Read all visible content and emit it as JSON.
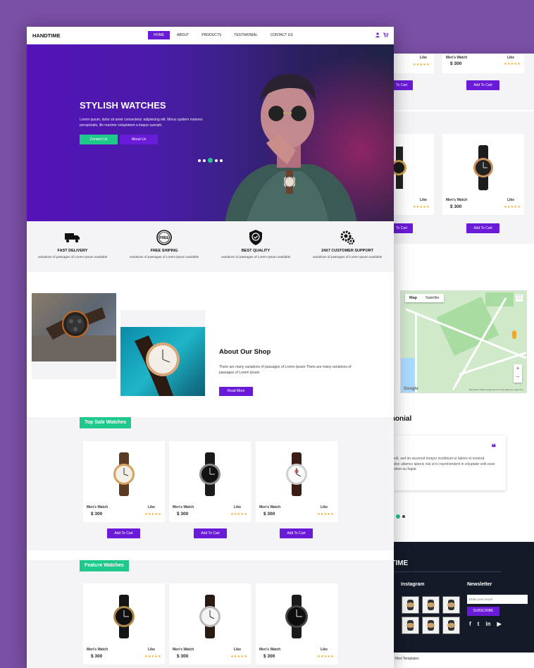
{
  "colors": {
    "accent": "#6a1bd8",
    "green": "#1ec98b",
    "star": "#f5a623",
    "footer": "#141a27"
  },
  "nav": {
    "brand": "HANDTIME",
    "items": [
      "HOME",
      "ABOUT",
      "PRODUCTS",
      "TESTIMONIAL",
      "CONTACT US"
    ],
    "active": 0
  },
  "hero": {
    "title": "STYLISH WATCHES",
    "text": "Lorem ipsum, dolor sit amet consectetur adipisicing elit. Minus quidem maiores perspiciatis, illo maxime voluptatem a itaque suscipit.",
    "btn_contact": "Contact Us",
    "btn_about": "About Us"
  },
  "features": [
    {
      "icon": "truck-icon",
      "title": "FAST DELIVERY",
      "desc": "variations of passages of Lorem Ipsum available"
    },
    {
      "icon": "free-badge-icon",
      "title": "FREE SHIPING",
      "desc": "variations of passages of Lorem Ipsum available"
    },
    {
      "icon": "quality-shield-icon",
      "title": "BEST QUALITY",
      "desc": "variations of passages of Lorem Ipsum available"
    },
    {
      "icon": "support-gear-icon",
      "title": "24X7 CUSTOMER SUPPORT",
      "desc": "variations of passages of Lorem Ipsum available"
    }
  ],
  "about": {
    "title": "About Our Shop",
    "text": "There are many variations of passages of Lorem Ipsum There are many variations of passages of Lorem Ipsum",
    "btn": "Read More"
  },
  "top_sale": {
    "label": "Top Sale Watches",
    "products": [
      {
        "name": "Men's Watch",
        "like": "Like",
        "price": "$ 300",
        "stars": "★★★★★",
        "btn": "Add To Cart"
      },
      {
        "name": "Men's Watch",
        "like": "Like",
        "price": "$ 300",
        "stars": "★★★★★",
        "btn": "Add To Cart"
      },
      {
        "name": "Men's Watch",
        "like": "Like",
        "price": "$ 300",
        "stars": "★★★★★",
        "btn": "Add To Cart"
      }
    ]
  },
  "feature_watches": {
    "label": "Feature Watches",
    "products": [
      {
        "name": "Men's Watch",
        "like": "Like",
        "price": "$ 300",
        "stars": "★★★★★"
      },
      {
        "name": "Men's Watch",
        "like": "Like",
        "price": "$ 300",
        "stars": "★★★★★"
      },
      {
        "name": "Men's Watch",
        "like": "Like",
        "price": "$ 300",
        "stars": "★★★★★"
      }
    ]
  },
  "back": {
    "row1": [
      {
        "like": "Like",
        "stars": "★★★★★",
        "btn": "To Cart"
      },
      {
        "name": "Men's Watch",
        "like": "Like",
        "price": "$ 300",
        "stars": "★★★★★",
        "btn": "Add To Cart"
      }
    ],
    "row2": [
      {
        "like": "Like",
        "stars": "★★★★★",
        "btn": "To Cart"
      },
      {
        "name": "Men's Watch",
        "like": "Like",
        "price": "$ 300",
        "stars": "★★★★★",
        "btn": "Add To Cart"
      }
    ],
    "map": {
      "tab_map": "Map",
      "tab_sat": "Satellite",
      "footer": "Map data ©2020 Google   Terms of Use   Report a map error",
      "logo": "Google"
    },
    "testimonial": {
      "title": "monial",
      "quote": "66",
      "text": "piscing elit, sed do eiusmod tempor incididunt ut labore et nostrud exercitation ullamco laboris nisi ut in reprehenderit in voluptate velit esse cillum dolore eu fugiat"
    },
    "footer": {
      "brand": "DTIME",
      "instagram": "Instagram",
      "newsletter": "Newsletter",
      "email_placeholder": "Enter your email",
      "subscribe": "SUBSCRIBE",
      "copyright": "ved By Free Html Templates"
    }
  }
}
